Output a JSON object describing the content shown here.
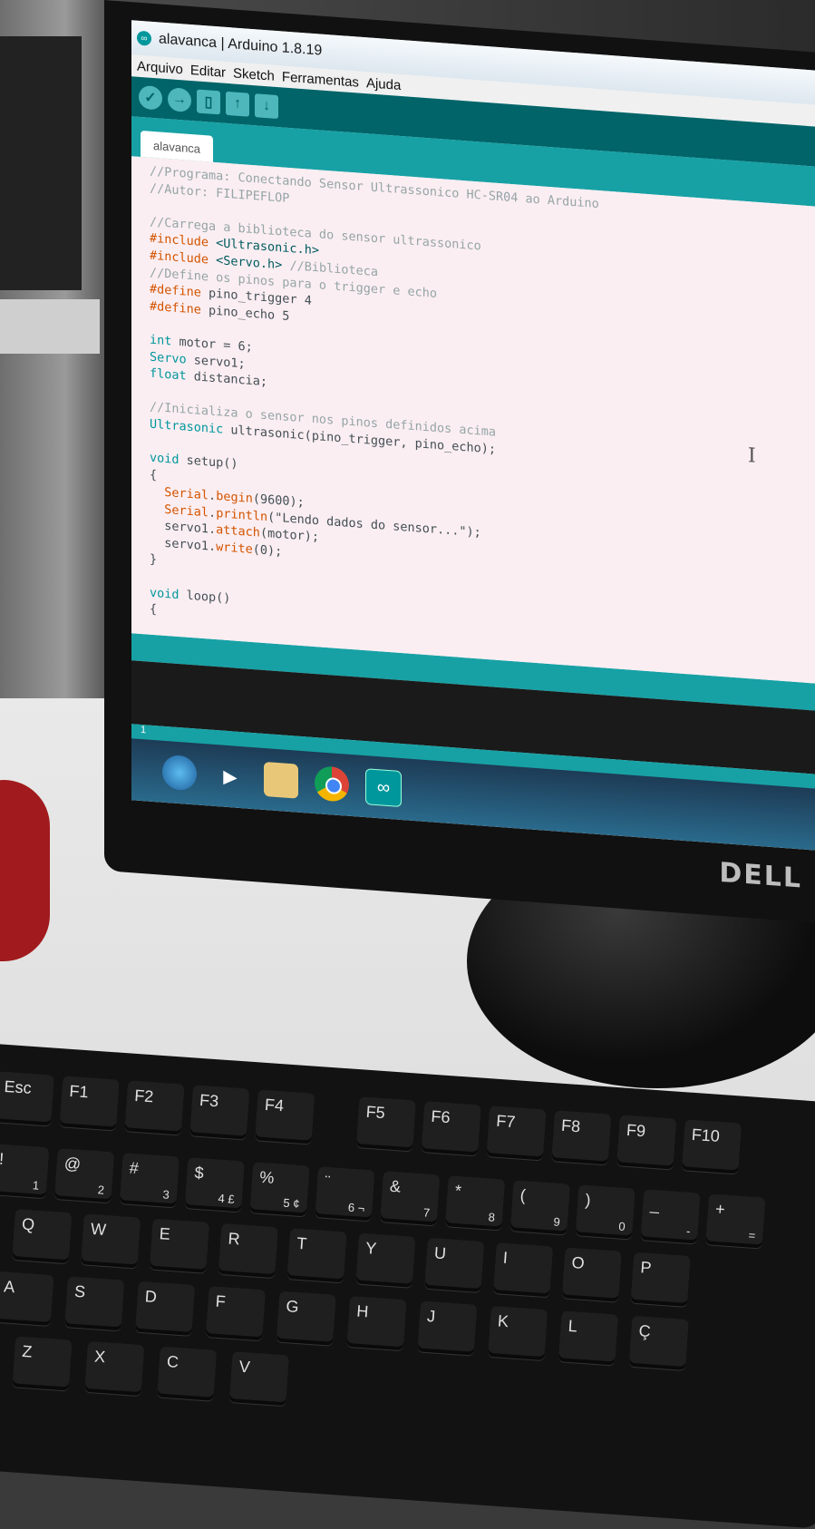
{
  "window": {
    "title": "alavanca | Arduino 1.8.19"
  },
  "menu": [
    "Arquivo",
    "Editar",
    "Sketch",
    "Ferramentas",
    "Ajuda"
  ],
  "toolbar": {
    "buttons": [
      "verify",
      "upload",
      "new",
      "open",
      "save"
    ]
  },
  "tab": {
    "label": "alavanca"
  },
  "code": [
    [
      [
        "cm",
        "//Programa: Conectando Sensor Ultrassonico HC-SR04 ao Arduino"
      ]
    ],
    [
      [
        "cm",
        "//Autor: FILIPEFLOP"
      ]
    ],
    [
      [
        "",
        ""
      ]
    ],
    [
      [
        "cm",
        "//Carrega a biblioteca do sensor ultrassonico"
      ]
    ],
    [
      [
        "kw",
        "#include "
      ],
      [
        "str",
        "<Ultrasonic.h>"
      ]
    ],
    [
      [
        "kw",
        "#include "
      ],
      [
        "str",
        "<Servo.h>"
      ],
      [
        "cm",
        " //Biblioteca"
      ]
    ],
    [
      [
        "cm",
        "//Define os pinos para o trigger e echo"
      ]
    ],
    [
      [
        "kw",
        "#define"
      ],
      [
        "",
        " pino_trigger 4"
      ]
    ],
    [
      [
        "kw",
        "#define"
      ],
      [
        "",
        " pino_echo 5"
      ]
    ],
    [
      [
        "",
        ""
      ]
    ],
    [
      [
        "ty",
        "int"
      ],
      [
        "",
        " motor = 6;"
      ]
    ],
    [
      [
        "ty",
        "Servo"
      ],
      [
        "",
        " servo1;"
      ]
    ],
    [
      [
        "ty",
        "float"
      ],
      [
        "",
        " distancia;"
      ]
    ],
    [
      [
        "",
        ""
      ]
    ],
    [
      [
        "cm",
        "//Inicializa o sensor nos pinos definidos acima"
      ]
    ],
    [
      [
        "ty",
        "Ultrasonic"
      ],
      [
        "",
        " ultrasonic(pino_trigger, pino_echo);"
      ]
    ],
    [
      [
        "",
        ""
      ]
    ],
    [
      [
        "ty",
        "void"
      ],
      [
        "",
        " setup()"
      ]
    ],
    [
      [
        "",
        "{"
      ]
    ],
    [
      [
        "",
        "  "
      ],
      [
        "fn",
        "Serial"
      ],
      [
        ".",
        ""
      ],
      [
        "fn",
        "begin"
      ],
      [
        "",
        "(9600);"
      ]
    ],
    [
      [
        "",
        "  "
      ],
      [
        "fn",
        "Serial"
      ],
      [
        ".",
        ""
      ],
      [
        "fn",
        "println"
      ],
      [
        "",
        "(\"Lendo dados do sensor...\");"
      ]
    ],
    [
      [
        "",
        "  servo1."
      ],
      [
        "fn",
        "attach"
      ],
      [
        "",
        "(motor);"
      ]
    ],
    [
      [
        "",
        "  servo1."
      ],
      [
        "fn",
        "write"
      ],
      [
        "",
        "(0);"
      ]
    ],
    [
      [
        "",
        "}"
      ]
    ],
    [
      [
        "",
        ""
      ]
    ],
    [
      [
        "ty",
        "void"
      ],
      [
        "",
        " loop()"
      ]
    ],
    [
      [
        "",
        "{"
      ]
    ]
  ],
  "statusbar": {
    "line": "1"
  },
  "taskbar": [
    "start",
    "media-player",
    "file-explorer",
    "chrome",
    "arduino"
  ],
  "monitor_brand": "DELL",
  "keyboard": {
    "rows": [
      [
        {
          "k": "Esc"
        },
        {
          "k": "F1"
        },
        {
          "k": "F2"
        },
        {
          "k": "F3"
        },
        {
          "k": "F4"
        },
        {
          "k": "F5"
        },
        {
          "k": "F6"
        },
        {
          "k": "F7"
        },
        {
          "k": "F8"
        },
        {
          "k": "F9"
        },
        {
          "k": "F10"
        }
      ],
      [
        {
          "k": "!",
          "s": "1"
        },
        {
          "k": "@",
          "s": "2"
        },
        {
          "k": "#",
          "s": "3"
        },
        {
          "k": "$",
          "s": "4 £"
        },
        {
          "k": "%",
          "s": "5 ¢"
        },
        {
          "k": "¨",
          "s": "6 ¬"
        },
        {
          "k": "&",
          "s": "7"
        },
        {
          "k": "*",
          "s": "8"
        },
        {
          "k": "(",
          "s": "9"
        },
        {
          "k": ")",
          "s": "0"
        },
        {
          "k": "_",
          "s": "-"
        },
        {
          "k": "+",
          "s": "="
        }
      ],
      [
        {
          "k": "Q"
        },
        {
          "k": "W"
        },
        {
          "k": "E"
        },
        {
          "k": "R"
        },
        {
          "k": "T"
        },
        {
          "k": "Y"
        },
        {
          "k": "U"
        },
        {
          "k": "I"
        },
        {
          "k": "O"
        },
        {
          "k": "P"
        }
      ],
      [
        {
          "k": "A"
        },
        {
          "k": "S"
        },
        {
          "k": "D"
        },
        {
          "k": "F"
        },
        {
          "k": "G"
        },
        {
          "k": "H"
        },
        {
          "k": "J"
        },
        {
          "k": "K"
        },
        {
          "k": "L"
        },
        {
          "k": "Ç"
        }
      ],
      [
        {
          "k": "Z"
        },
        {
          "k": "X"
        },
        {
          "k": "C"
        },
        {
          "k": "V"
        }
      ]
    ]
  }
}
